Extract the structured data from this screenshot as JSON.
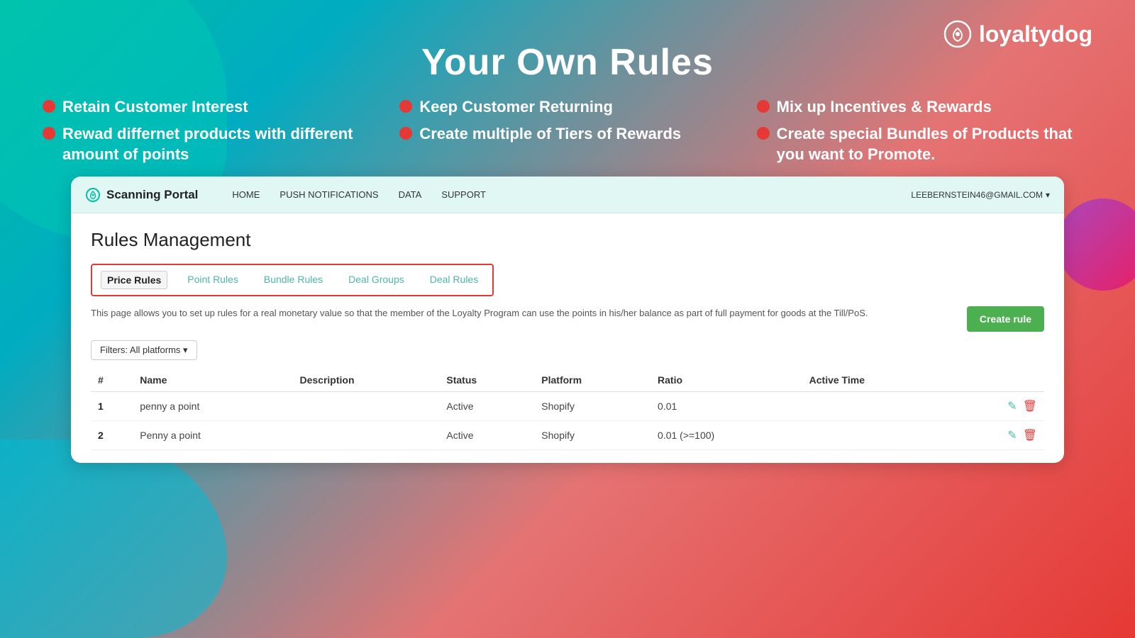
{
  "background": {
    "gradient": "teal to red"
  },
  "logo": {
    "icon": "loyaltydog-icon",
    "text": "loyaltydog"
  },
  "main_title": "Your Own Rules",
  "features": [
    {
      "text": "Retain Customer Interest",
      "col": 1
    },
    {
      "text": "Keep Customer Returning",
      "col": 2
    },
    {
      "text": "Mix up Incentives & Rewards",
      "col": 3
    },
    {
      "text": "Rewad differnet products with different amount of points",
      "col": 1
    },
    {
      "text": "Create multiple of Tiers of Rewards",
      "col": 2
    },
    {
      "text": "Create special Bundles of Products that you want to Promote.",
      "col": 3
    }
  ],
  "portal": {
    "brand": "Scanning Portal",
    "nav": {
      "home": "HOME",
      "push": "PUSH NOTIFICATIONS",
      "data": "DATA",
      "support": "SUPPORT",
      "user": "LEEBERNSTEIN46@GMAIL.COM"
    },
    "page_title": "Rules Management",
    "tabs": [
      {
        "label": "Price Rules",
        "active": true
      },
      {
        "label": "Point Rules",
        "active": false
      },
      {
        "label": "Bundle Rules",
        "active": false
      },
      {
        "label": "Deal Groups",
        "active": false
      },
      {
        "label": "Deal Rules",
        "active": false
      }
    ],
    "description": "This page allows you to set up rules for a real monetary value so that the member of the Loyalty Program can use the points in his/her balance as part of full payment for goods at the Till/PoS.",
    "create_rule_label": "Create rule",
    "filter_label": "Filters: All platforms ▾",
    "table": {
      "headers": [
        "#",
        "Name",
        "Description",
        "Status",
        "Platform",
        "Ratio",
        "Active Time",
        ""
      ],
      "rows": [
        {
          "num": "1",
          "name": "penny a point",
          "description": "",
          "status": "Active",
          "platform": "Shopify",
          "ratio": "0.01",
          "active_time": ""
        },
        {
          "num": "2",
          "name": "Penny a point",
          "description": "",
          "status": "Active",
          "platform": "Shopify",
          "ratio": "0.01 (>=100)",
          "active_time": ""
        }
      ]
    }
  }
}
